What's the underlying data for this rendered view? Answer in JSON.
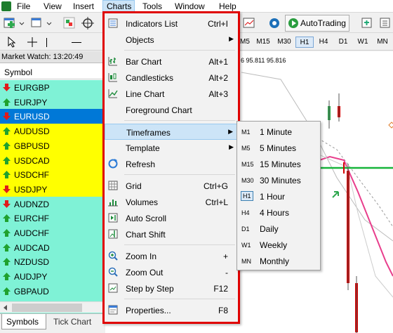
{
  "menubar": {
    "items": [
      "File",
      "View",
      "Insert",
      "Charts",
      "Tools",
      "Window",
      "Help"
    ]
  },
  "toolbar": {
    "autotrading_label": "AutoTrading"
  },
  "timeframe_bar": [
    "M5",
    "M15",
    "M30",
    "H1",
    "H4",
    "D1",
    "W1",
    "MN"
  ],
  "chart": {
    "info_text": "6 95.811 95.816"
  },
  "market_watch": {
    "title": "Market Watch: 13:20:49",
    "column_header": "Symbol",
    "symbols": [
      {
        "name": "EURGBP",
        "dir": "down",
        "color": "#7ff2d6"
      },
      {
        "name": "EURJPY",
        "dir": "up",
        "color": "#7ff2d6"
      },
      {
        "name": "EURUSD",
        "dir": "down",
        "color": "#0078d7",
        "selected": true
      },
      {
        "name": "AUDUSD",
        "dir": "up",
        "color": "#ffff00"
      },
      {
        "name": "GBPUSD",
        "dir": "up",
        "color": "#ffff00"
      },
      {
        "name": "USDCAD",
        "dir": "up",
        "color": "#ffff00"
      },
      {
        "name": "USDCHF",
        "dir": "up",
        "color": "#ffff00"
      },
      {
        "name": "USDJPY",
        "dir": "down",
        "color": "#ffff00"
      },
      {
        "name": "AUDNZD",
        "dir": "down",
        "color": "#7ff2d6"
      },
      {
        "name": "EURCHF",
        "dir": "up",
        "color": "#7ff2d6"
      },
      {
        "name": "AUDCHF",
        "dir": "up",
        "color": "#7ff2d6"
      },
      {
        "name": "AUDCAD",
        "dir": "up",
        "color": "#7ff2d6"
      },
      {
        "name": "NZDUSD",
        "dir": "up",
        "color": "#7ff2d6"
      },
      {
        "name": "AUDJPY",
        "dir": "up",
        "color": "#7ff2d6"
      },
      {
        "name": "GBPAUD",
        "dir": "up",
        "color": "#7ff2d6"
      },
      {
        "name": "GBPJPY",
        "dir": "up",
        "color": "#7ff2d6"
      }
    ],
    "tabs": [
      "Symbols",
      "Tick Chart"
    ]
  },
  "charts_menu": [
    {
      "label": "Indicators List",
      "shortcut": "Ctrl+I",
      "icon": "indicators-list-icon"
    },
    {
      "label": "Objects",
      "submenu": true,
      "icon": ""
    },
    {
      "sep": true
    },
    {
      "label": "Bar Chart",
      "shortcut": "Alt+1",
      "icon": "bar-chart-icon"
    },
    {
      "label": "Candlesticks",
      "shortcut": "Alt+2",
      "icon": "candlesticks-icon"
    },
    {
      "label": "Line Chart",
      "shortcut": "Alt+3",
      "icon": "line-chart-icon"
    },
    {
      "label": "Foreground Chart",
      "icon": ""
    },
    {
      "sep": true
    },
    {
      "label": "Timeframes",
      "submenu": true,
      "highlight": true,
      "icon": ""
    },
    {
      "label": "Template",
      "submenu": true,
      "icon": ""
    },
    {
      "label": "Refresh",
      "icon": "refresh-icon"
    },
    {
      "sep": true
    },
    {
      "label": "Grid",
      "shortcut": "Ctrl+G",
      "icon": "grid-icon"
    },
    {
      "label": "Volumes",
      "shortcut": "Ctrl+L",
      "icon": "volumes-icon"
    },
    {
      "label": "Auto Scroll",
      "icon": "auto-scroll-icon"
    },
    {
      "label": "Chart Shift",
      "icon": "chart-shift-icon"
    },
    {
      "sep": true
    },
    {
      "label": "Zoom In",
      "shortcut": "+",
      "icon": "zoom-in-icon"
    },
    {
      "label": "Zoom Out",
      "shortcut": "-",
      "icon": "zoom-out-icon"
    },
    {
      "label": "Step by Step",
      "shortcut": "F12",
      "icon": "step-by-step-icon"
    },
    {
      "sep": true
    },
    {
      "label": "Properties...",
      "shortcut": "F8",
      "icon": "properties-icon"
    }
  ],
  "timeframes_menu": [
    {
      "code": "M1",
      "label": "1 Minute"
    },
    {
      "code": "M5",
      "label": "5 Minutes"
    },
    {
      "code": "M15",
      "label": "15 Minutes"
    },
    {
      "code": "M30",
      "label": "30 Minutes"
    },
    {
      "code": "H1",
      "label": "1 Hour",
      "selected": true
    },
    {
      "code": "H4",
      "label": "4 Hours"
    },
    {
      "code": "D1",
      "label": "Daily"
    },
    {
      "code": "W1",
      "label": "Weekly"
    },
    {
      "code": "MN",
      "label": "Monthly"
    }
  ]
}
